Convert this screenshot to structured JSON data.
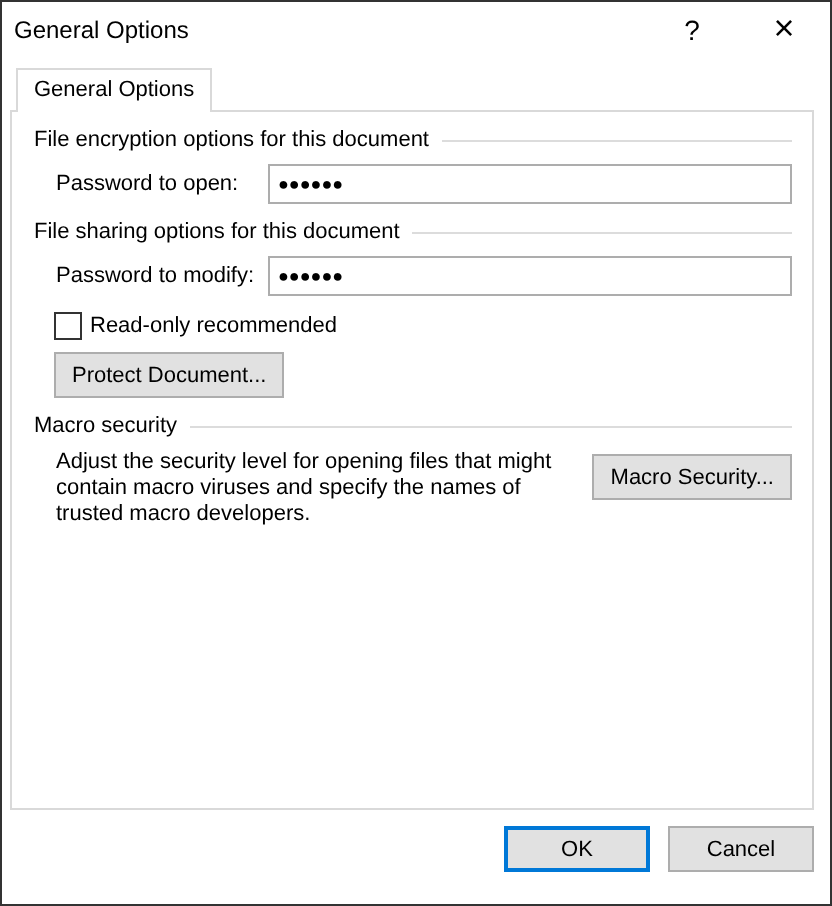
{
  "window": {
    "title": "General Options",
    "help": "?",
    "close": "×"
  },
  "tabs": [
    {
      "label": "General Options",
      "selected": true
    }
  ],
  "encryption": {
    "heading": "File encryption options for this document",
    "label": "Password to open:",
    "value": "●●●●●●"
  },
  "sharing": {
    "heading": "File sharing options for this document",
    "label": "Password to modify:",
    "value": "●●●●●●",
    "read_only": {
      "label": "Read-only recommended",
      "checked": false
    },
    "protect_button": "Protect Document..."
  },
  "macro": {
    "heading": "Macro security",
    "description": "Adjust the security level for opening files that might contain macro viruses and specify the names of trusted macro developers.",
    "button": "Macro Security..."
  },
  "buttons": [
    {
      "label": "OK",
      "default": true
    },
    {
      "label": "Cancel",
      "default": false
    }
  ]
}
